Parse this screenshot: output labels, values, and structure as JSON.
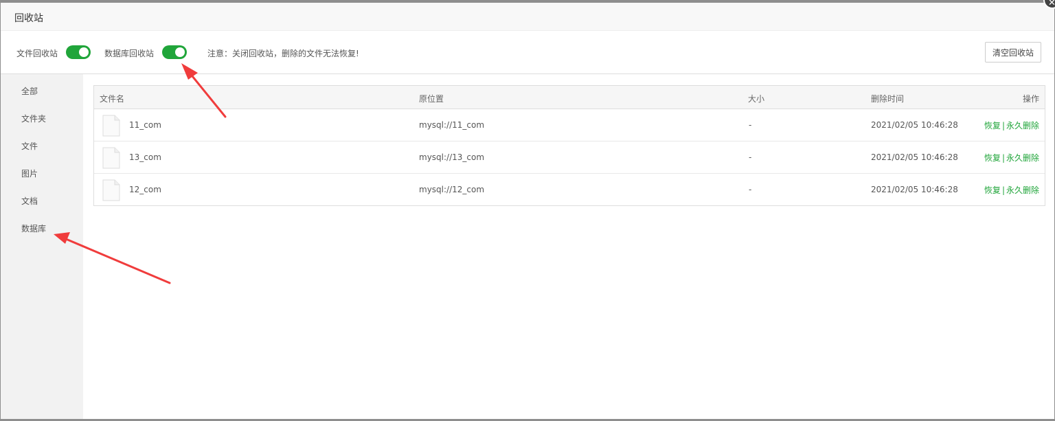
{
  "dialog": {
    "title": "回收站",
    "close_glyph": "✕"
  },
  "toolbar": {
    "file_recycle_label": "文件回收站",
    "file_recycle_on": true,
    "db_recycle_label": "数据库回收站",
    "db_recycle_on": true,
    "notice": "注意：关闭回收站，删除的文件无法恢复!",
    "clear_button": "清空回收站"
  },
  "sidebar": {
    "items": [
      {
        "label": "全部"
      },
      {
        "label": "文件夹"
      },
      {
        "label": "文件"
      },
      {
        "label": "图片"
      },
      {
        "label": "文档"
      },
      {
        "label": "数据库"
      }
    ],
    "active_index": 5
  },
  "table": {
    "headers": {
      "name": "文件名",
      "origin": "原位置",
      "size": "大小",
      "deleted_time": "删除时间",
      "actions": "操作"
    },
    "rows": [
      {
        "name": "11_com",
        "origin": "mysql://11_com",
        "size": "-",
        "deleted_time": "2021/02/05 10:46:28",
        "restore": "恢复",
        "separator": "|",
        "delete": "永久删除"
      },
      {
        "name": "13_com",
        "origin": "mysql://13_com",
        "size": "-",
        "deleted_time": "2021/02/05 10:46:28",
        "restore": "恢复",
        "separator": "|",
        "delete": "永久删除"
      },
      {
        "name": "12_com",
        "origin": "mysql://12_com",
        "size": "-",
        "deleted_time": "2021/02/05 10:46:28",
        "restore": "恢复",
        "separator": "|",
        "delete": "永久删除"
      }
    ]
  },
  "colors": {
    "accent": "#20a53a",
    "annotation_arrow": "#f03c3c",
    "sidebar_bg": "#f2f2f2"
  }
}
